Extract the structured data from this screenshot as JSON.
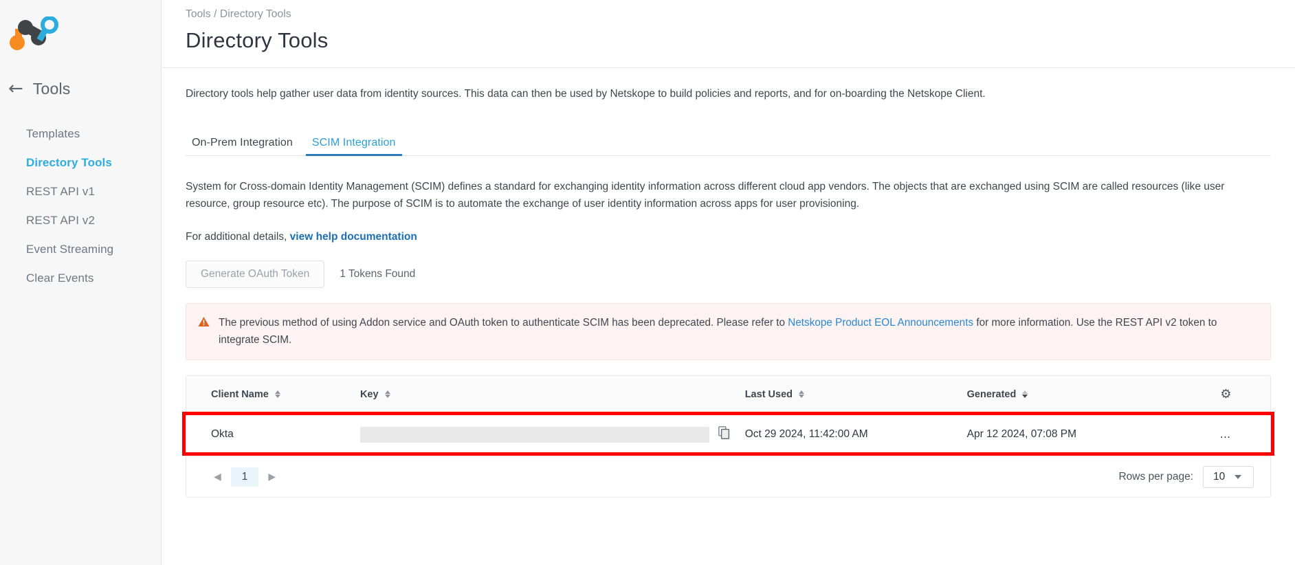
{
  "sidebar": {
    "logo_name": "netskope-logo",
    "back_label": "Tools",
    "items": [
      {
        "label": "Templates",
        "active": false
      },
      {
        "label": "Directory Tools",
        "active": true
      },
      {
        "label": "REST API v1",
        "active": false
      },
      {
        "label": "REST API v2",
        "active": false
      },
      {
        "label": "Event Streaming",
        "active": false
      },
      {
        "label": "Clear Events",
        "active": false
      }
    ]
  },
  "header": {
    "breadcrumb": "Tools / Directory Tools",
    "title": "Directory Tools"
  },
  "main": {
    "intro": "Directory tools help gather user data from identity sources. This data can then be used by Netskope to build policies and reports, and for on-boarding the Netskope Client.",
    "tabs": [
      {
        "label": "On-Prem Integration",
        "active": false
      },
      {
        "label": "SCIM Integration",
        "active": true
      }
    ],
    "scim_description": "System for Cross-domain Identity Management (SCIM) defines a standard for exchanging identity information across different cloud app vendors. The objects that are exchanged using SCIM are called resources (like user resource, group resource etc). The purpose of SCIM is to automate the exchange of user identity information across apps for user provisioning.",
    "help_prefix": "For additional details,",
    "help_link": "view help documentation",
    "generate_button": "Generate OAuth Token",
    "tokens_found": "1 Tokens Found",
    "alert": {
      "icon": "warning-triangle-icon",
      "text_before_link": "The previous method of using Addon service and OAuth token to authenticate SCIM has been deprecated. Please refer to",
      "link": "Netskope Product EOL Announcements",
      "text_after_link": "for more information. Use the REST API v2 token to integrate SCIM."
    },
    "table": {
      "columns": [
        {
          "label": "Client Name",
          "sortable": true,
          "sort": "none"
        },
        {
          "label": "Key",
          "sortable": true,
          "sort": "none"
        },
        {
          "label": "Last Used",
          "sortable": true,
          "sort": "none"
        },
        {
          "label": "Generated",
          "sortable": true,
          "sort": "desc"
        }
      ],
      "settings_icon": "gear-icon",
      "rows": [
        {
          "client_name": "Okta",
          "key": "",
          "key_masked": true,
          "last_used": "Oct 29 2024, 11:42:00 AM",
          "generated": "Apr 12 2024, 07:08 PM",
          "row_menu": "…"
        }
      ]
    },
    "pagination": {
      "prev": "◀",
      "page": "1",
      "next": "▶",
      "rows_per_page_label": "Rows per page:",
      "rows_per_page_value": "10"
    }
  },
  "colors": {
    "accent_blue": "#2cadde",
    "tab_active": "#2b7bb9",
    "link": "#1c6fb5",
    "alert_bg": "#fdf3f2",
    "warning": "#d9631f",
    "highlight_red": "#fe0000"
  }
}
